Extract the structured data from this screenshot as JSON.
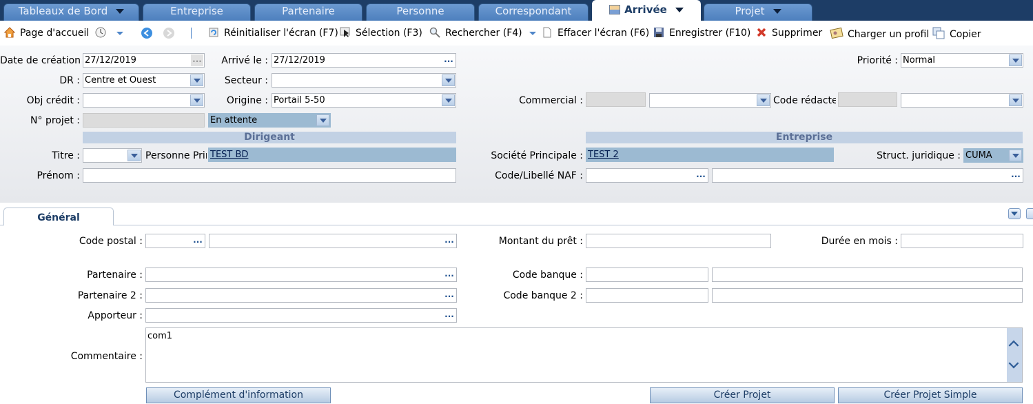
{
  "tabs": [
    {
      "label": "Tableaux de Bord"
    },
    {
      "label": "Entreprise"
    },
    {
      "label": "Partenaire"
    },
    {
      "label": "Personne"
    },
    {
      "label": "Correspondant"
    },
    {
      "label": "Arrivée"
    },
    {
      "label": "Projet"
    }
  ],
  "toolbar": {
    "home": "Page d'accueil",
    "reset": "Réinitialiser l'écran (F7)",
    "selection": "Sélection (F3)",
    "search": "Rechercher (F4)",
    "clear": "Effacer l'écran (F6)",
    "save": "Enregistrer (F10)",
    "delete": "Supprimer",
    "load_profile": "Charger un profil",
    "copy": "Copier"
  },
  "form": {
    "date_creation_label": "Date de création :",
    "date_creation": "27/12/2019",
    "arrive_label": "Arrivé le :",
    "arrive": "27/12/2019",
    "priorite_label": "Priorité :",
    "priorite": "Normal",
    "dr_label": "DR :",
    "dr": "Centre et Ouest",
    "secteur_label": "Secteur :",
    "secteur": "",
    "obj_credit_label": "Obj crédit :",
    "obj_credit": "",
    "origine_label": "Origine :",
    "origine": "Portail 5-50",
    "commercial_label": "Commercial :",
    "commercial_code": "",
    "commercial": "",
    "code_redacteur_label": "Code rédacteur :",
    "code_redacteur": "",
    "code_redacteur_select": "",
    "num_projet_label": "N° projet :",
    "num_projet": "",
    "statut": "En attente",
    "dirigeant_header": "Dirigeant",
    "entreprise_header": "Entreprise",
    "titre_label": "Titre :",
    "titre": "",
    "personne_label": "Personne Principale :",
    "personne": "TEST BD",
    "societe_label": "Société Principale :",
    "societe": "TEST 2",
    "struct_label": "Struct. juridique :",
    "struct": "CUMA",
    "prenom_label": "Prénom :",
    "prenom": "",
    "naf_label": "Code/Libellé NAF :",
    "naf_code": "",
    "naf_libelle": ""
  },
  "general": {
    "tab_label": "Général",
    "code_postal_label": "Code postal :",
    "code_postal": "",
    "ville": "",
    "montant_label": "Montant du prêt :",
    "montant": "",
    "duree_label": "Durée en mois :",
    "duree": "",
    "partenaire_label": "Partenaire :",
    "partenaire": "",
    "code_banque_label": "Code banque :",
    "code_banque": "",
    "code_banque_libelle": "",
    "partenaire2_label": "Partenaire 2 :",
    "partenaire2": "",
    "code_banque2_label": "Code banque 2 :",
    "code_banque2": "",
    "code_banque2_libelle": "",
    "apporteur_label": "Apporteur :",
    "apporteur": "",
    "commentaire_label": "Commentaire :",
    "commentaire": "com1",
    "btn_complement": "Complément d'information",
    "btn_creer": "Créer Projet",
    "btn_creer_simple": "Créer Projet Simple"
  },
  "dots": "...",
  "colors": {
    "tabbar": "#1d3d66",
    "tab": "#5a89c6",
    "section": "#c2d1e4",
    "highlight": "#9cbad2"
  }
}
